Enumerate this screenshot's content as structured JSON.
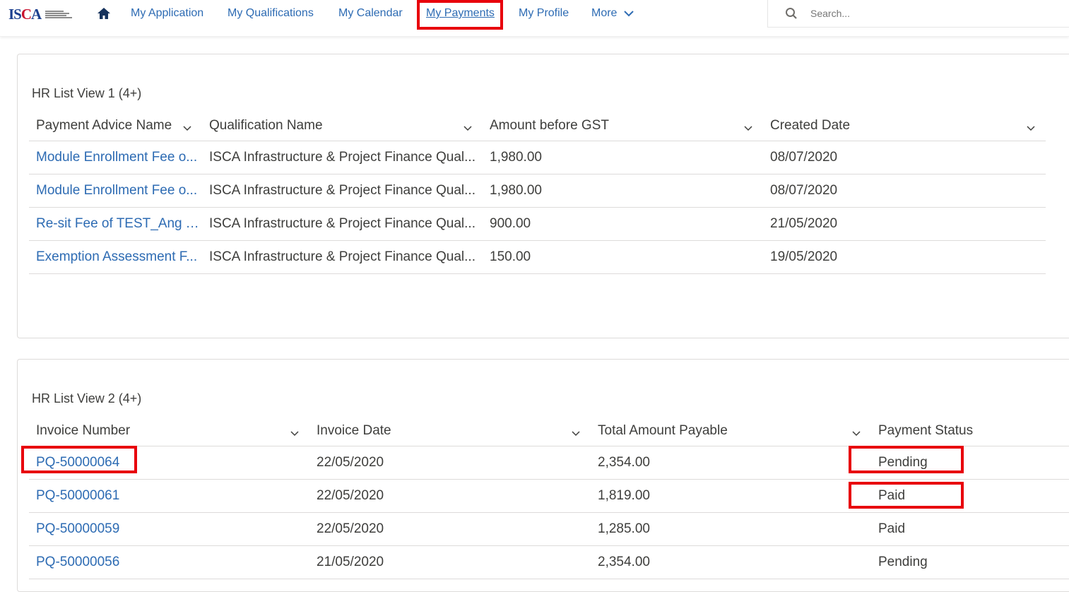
{
  "nav": {
    "logo_text": "ISCA",
    "items": [
      {
        "label": "My Application"
      },
      {
        "label": "My Qualifications"
      },
      {
        "label": "My Calendar"
      },
      {
        "label": "My Payments"
      },
      {
        "label": "My Profile"
      },
      {
        "label": "More"
      }
    ],
    "search_placeholder": "Search..."
  },
  "list1": {
    "title": "HR List View 1 (4+)",
    "columns": [
      "Payment Advice Name",
      "Qualification Name",
      "Amount before GST",
      "Created Date"
    ],
    "rows": [
      [
        "Module Enrollment Fee o...",
        "ISCA Infrastructure & Project Finance Qual...",
        "1,980.00",
        "08/07/2020"
      ],
      [
        "Module Enrollment Fee o...",
        "ISCA Infrastructure & Project Finance Qual...",
        "1,980.00",
        "08/07/2020"
      ],
      [
        "Re-sit Fee of TEST_Ang Y...",
        "ISCA Infrastructure & Project Finance Qual...",
        "900.00",
        "21/05/2020"
      ],
      [
        "Exemption Assessment F...",
        "ISCA Infrastructure & Project Finance Qual...",
        "150.00",
        "19/05/2020"
      ]
    ]
  },
  "list2": {
    "title": "HR List View 2 (4+)",
    "columns": [
      "Invoice Number",
      "Invoice Date",
      "Total Amount Payable",
      "Payment Status"
    ],
    "rows": [
      [
        "PQ-50000064",
        "22/05/2020",
        "2,354.00",
        "Pending"
      ],
      [
        "PQ-50000061",
        "22/05/2020",
        "1,819.00",
        "Paid"
      ],
      [
        "PQ-50000059",
        "22/05/2020",
        "1,285.00",
        "Paid"
      ],
      [
        "PQ-50000056",
        "21/05/2020",
        "2,354.00",
        "Pending"
      ]
    ]
  },
  "colors": {
    "link": "#2d6bb3",
    "highlight": "#e8000b",
    "border": "#dddbda"
  }
}
